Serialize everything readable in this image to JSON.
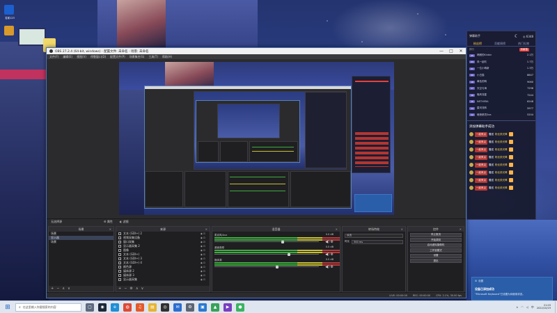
{
  "desktop": {
    "icons": [
      {
        "name": "app-icon-1",
        "label": "名前123",
        "color": "#1c5fcf"
      },
      {
        "name": "app-icon-2",
        "label": "",
        "color": "#d89a2a"
      }
    ]
  },
  "obs": {
    "title": "OBS 27.2.4 (64-bit, windows) - 配置文件: 未命名 - 场景: 未命名",
    "window_buttons": {
      "minimize": "—",
      "maximize": "□",
      "close": "✕"
    },
    "menu": [
      "文件(F)",
      "编辑(E)",
      "视图(V)",
      "停靠窗口(D)",
      "配置文件(P)",
      "场景集合(S)",
      "工具(T)",
      "帮助(H)"
    ],
    "status_label": "无选择源",
    "status_props": "⚙ 属性",
    "status_filters": "◐ 滤镜",
    "docks": {
      "scenes": {
        "title": "场景",
        "items": [
          "场景",
          "显示器",
          "场景"
        ],
        "selected_index": 1
      },
      "sources": {
        "title": "来源",
        "items": [
          {
            "label": "文本 (GDI+) 2",
            "icon": "text-icon"
          },
          {
            "label": "视频采集设备",
            "icon": "camera-icon"
          },
          {
            "label": "窗口采集",
            "icon": "window-icon"
          },
          {
            "label": "显示器采集 2",
            "icon": "monitor-icon"
          },
          {
            "label": "图像",
            "icon": "image-icon"
          },
          {
            "label": "文本 (GDI+)",
            "icon": "text-icon"
          },
          {
            "label": "文本 (GDI+) 3",
            "icon": "text-icon"
          },
          {
            "label": "文本 (GDI+) 4",
            "icon": "text-icon"
          },
          {
            "label": "颜色源",
            "icon": "color-icon"
          },
          {
            "label": "媒体源 2",
            "icon": "media-icon"
          },
          {
            "label": "媒体源 3",
            "icon": "media-icon"
          },
          {
            "label": "显示器采集",
            "icon": "monitor-icon"
          }
        ]
      },
      "mixer": {
        "title": "混音器",
        "channels": [
          {
            "name": "麦克风/Aux",
            "db": "0.0 dB",
            "level": 0.66
          },
          {
            "name": "桌面音频",
            "db": "0.0 dB",
            "level": 0.72
          },
          {
            "name": "媒体源",
            "db": "0.0 dB",
            "level": 0.6
          }
        ]
      },
      "transitions": {
        "title": "转场特效",
        "type_value": "淡出",
        "duration_label": "时长",
        "duration_value": "300 ms"
      },
      "controls": {
        "title": "控件",
        "buttons": [
          "停止推流",
          "开始录制",
          "启动虚拟摄像机",
          "工作室模式",
          "设置",
          "退出"
        ]
      }
    },
    "bottom_status": [
      "LIVE: 00:00:00",
      "REC: 00:00:00",
      "CPU: 2.1%, 30.00 fps"
    ]
  },
  "chat": {
    "header": "弹幕助手",
    "count": "◎ 6348",
    "tabs": [
      "粉丝榜",
      "贡献周榜",
      "热门礼物"
    ],
    "active_tab": 0,
    "columns": {
      "left": "排行",
      "badge": "贡献值"
    },
    "ranks": [
      {
        "level": "25",
        "name": "晴朗的Kinbin",
        "score": "2.1万"
      },
      {
        "level": "23",
        "name": "风一起吹",
        "score": "1.7万"
      },
      {
        "level": "21",
        "name": "一位小萌新",
        "score": "1.3万"
      },
      {
        "level": "20",
        "name": "小白猫",
        "score": "8847"
      },
      {
        "level": "18",
        "name": "黄色的鸭",
        "score": "9060"
      },
      {
        "level": "17",
        "name": "天空与海",
        "score": "7296"
      },
      {
        "level": "16",
        "name": "晚风流星",
        "score": "7244"
      },
      {
        "level": "15",
        "name": "NETHERA",
        "score": "6248"
      },
      {
        "level": "14",
        "name": "星河流转",
        "score": "5977"
      },
      {
        "level": "12",
        "name": "暗夜精灵Sea",
        "score": "5204"
      }
    ],
    "gift_title": "添加弹幕助手成功",
    "gifts": [
      {
        "user": "一起来瓜",
        "word": "赠送",
        "gift": "粉丝荧光棒"
      },
      {
        "user": "一起来瓜",
        "word": "赠送",
        "gift": "粉丝荧光棒"
      },
      {
        "user": "一起来瓜",
        "word": "赠送",
        "gift": "粉丝荧光棒"
      },
      {
        "user": "一起来瓜",
        "word": "赠送",
        "gift": "粉丝荧光棒"
      },
      {
        "user": "一起来瓜",
        "word": "赠送",
        "gift": "粉丝荧光棒"
      },
      {
        "user": "一起来瓜",
        "word": "赠送",
        "gift": "粉丝荧光棒"
      },
      {
        "user": "一起来瓜",
        "word": "赠送",
        "gift": "粉丝荧光棒"
      },
      {
        "user": "一起来瓜",
        "word": "赠送",
        "gift": "粉丝荧光棒"
      }
    ]
  },
  "toast": {
    "app": "设置",
    "title": "设备已添加成功",
    "message": "\"Microsoft Keyboard\"已设置为待使用状态。"
  },
  "taskbar": {
    "search_placeholder": "在这里输入你要搜索的内容",
    "apps": [
      {
        "name": "task-view-icon",
        "color": "#5d6a7e",
        "glyph": "▢"
      },
      {
        "name": "steam-icon",
        "color": "#1b2838",
        "glyph": "◉"
      },
      {
        "name": "edge-icon",
        "color": "#1f8fd6",
        "glyph": "e"
      },
      {
        "name": "chrome-icon",
        "color": "#de4935",
        "glyph": "◍"
      },
      {
        "name": "music-icon",
        "color": "#e45a2b",
        "glyph": "♫"
      },
      {
        "name": "folder-icon",
        "color": "#e6b432",
        "glyph": "▤"
      },
      {
        "name": "obs-icon",
        "color": "#303030",
        "glyph": "◎"
      },
      {
        "name": "mail-icon",
        "color": "#2a6ed0",
        "glyph": "✉"
      },
      {
        "name": "settings-icon",
        "color": "#5b6573",
        "glyph": "⚙"
      },
      {
        "name": "store-icon",
        "color": "#2a7ad0",
        "glyph": "▣"
      },
      {
        "name": "game-icon",
        "color": "#37a35a",
        "glyph": "▲"
      },
      {
        "name": "video-icon",
        "color": "#7840c0",
        "glyph": "▶"
      },
      {
        "name": "chat-app-icon",
        "color": "#3bb463",
        "glyph": "●"
      }
    ],
    "time": "21:03",
    "date": "2022/10/19"
  }
}
